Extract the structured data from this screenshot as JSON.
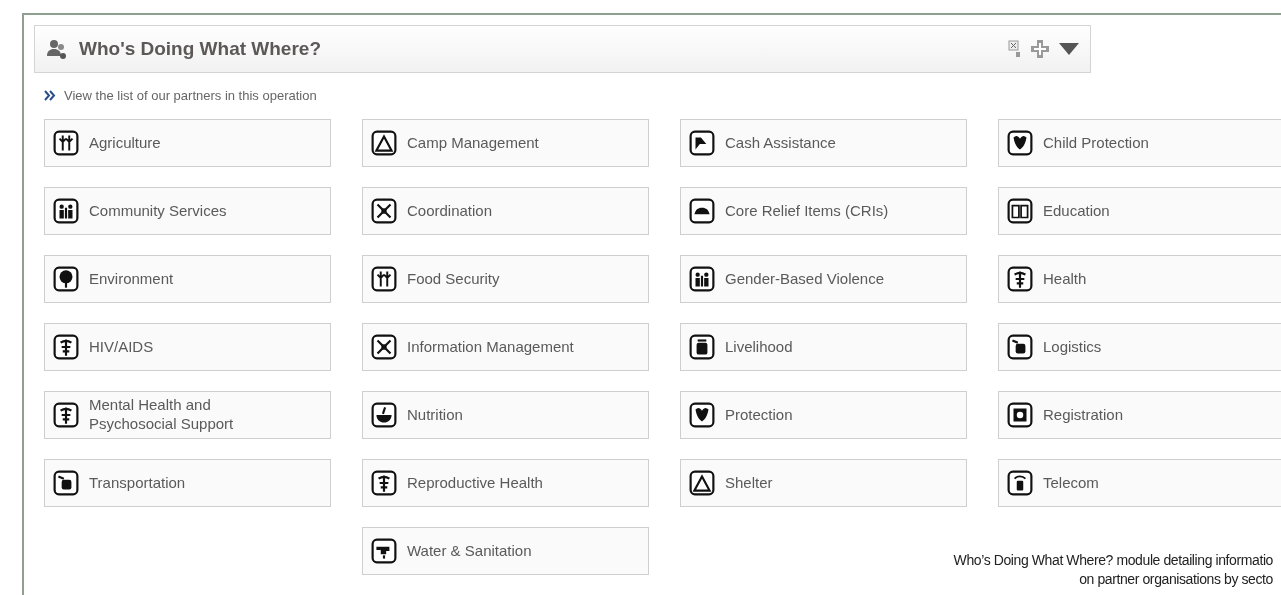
{
  "module": {
    "title": "Who's Doing What Where?",
    "link": "View the list of our partners in this operation"
  },
  "sectors": [
    {
      "label": "Agriculture"
    },
    {
      "label": "Camp Management"
    },
    {
      "label": "Cash Assistance"
    },
    {
      "label": "Child Protection"
    },
    {
      "label": "Community Services"
    },
    {
      "label": "Coordination"
    },
    {
      "label": "Core Relief Items (CRIs)"
    },
    {
      "label": "Education"
    },
    {
      "label": "Environment"
    },
    {
      "label": "Food Security"
    },
    {
      "label": "Gender-Based Violence"
    },
    {
      "label": "Health"
    },
    {
      "label": "HIV/AIDS"
    },
    {
      "label": "Information Management"
    },
    {
      "label": "Livelihood"
    },
    {
      "label": "Logistics"
    },
    {
      "label": "Mental Health and Psychosocial Support"
    },
    {
      "label": "Nutrition"
    },
    {
      "label": "Protection"
    },
    {
      "label": "Registration"
    },
    {
      "label": "Transportation"
    },
    {
      "label": "Reproductive Health"
    },
    {
      "label": "Shelter"
    },
    {
      "label": "Telecom"
    },
    {
      "label": "Water & Sanitation"
    }
  ],
  "caption": [
    "Who’s Doing What Where? module detailing informatio",
    "on partner organisations by secto"
  ]
}
